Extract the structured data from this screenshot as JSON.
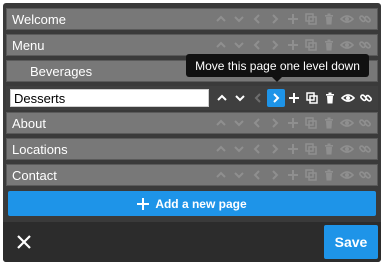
{
  "pages": [
    {
      "label": "Welcome",
      "indent": false
    },
    {
      "label": "Menu",
      "indent": false
    },
    {
      "label": "Beverages",
      "indent": true
    },
    {
      "label": "Desserts",
      "indent": false,
      "editing": true
    },
    {
      "label": "About",
      "indent": false
    },
    {
      "label": "Locations",
      "indent": false
    },
    {
      "label": "Contact",
      "indent": false
    }
  ],
  "tooltip": {
    "text": "Move this page one level down"
  },
  "add_page": {
    "label": "Add a new page"
  },
  "footer": {
    "save_label": "Save"
  },
  "icons": {
    "move_up": "chevron-up-icon",
    "move_down": "chevron-down-icon",
    "outdent": "chevron-left-icon",
    "indent": "chevron-right-icon",
    "add": "plus-icon",
    "duplicate": "copy-icon",
    "delete": "trash-icon",
    "visibility": "eye-icon",
    "link": "link-icon",
    "close": "close-icon"
  },
  "colors": {
    "accent": "#1e94e8",
    "row_bg": "#787878",
    "panel_bg": "#3a3a3a",
    "tooltip_bg": "#111111"
  }
}
